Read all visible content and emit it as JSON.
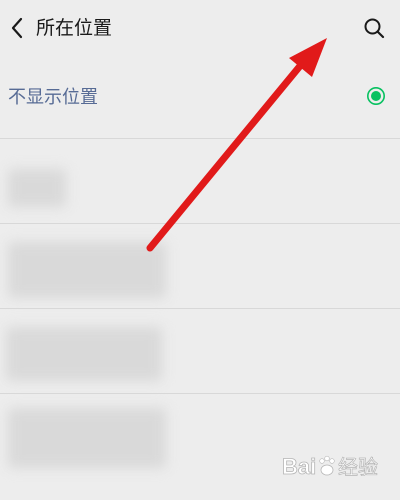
{
  "header": {
    "title": "所在位置",
    "back_icon": "chevron-left-icon",
    "search_icon": "search-icon"
  },
  "no_location": {
    "label": "不显示位置",
    "selected": true,
    "indicator_icon": "radio-selected-icon"
  },
  "places": [
    {
      "name": "",
      "address": ""
    },
    {
      "name": "",
      "address": ""
    },
    {
      "name": "",
      "address": ""
    },
    {
      "name": "",
      "address": ""
    }
  ],
  "watermark": {
    "brand": "Bai",
    "suffix": "经验"
  },
  "colors": {
    "background": "#ededed",
    "title": "#1a1a1a",
    "accent_link": "#576b95",
    "selected_green": "#07c160",
    "annotation_arrow": "#e11a1a"
  }
}
